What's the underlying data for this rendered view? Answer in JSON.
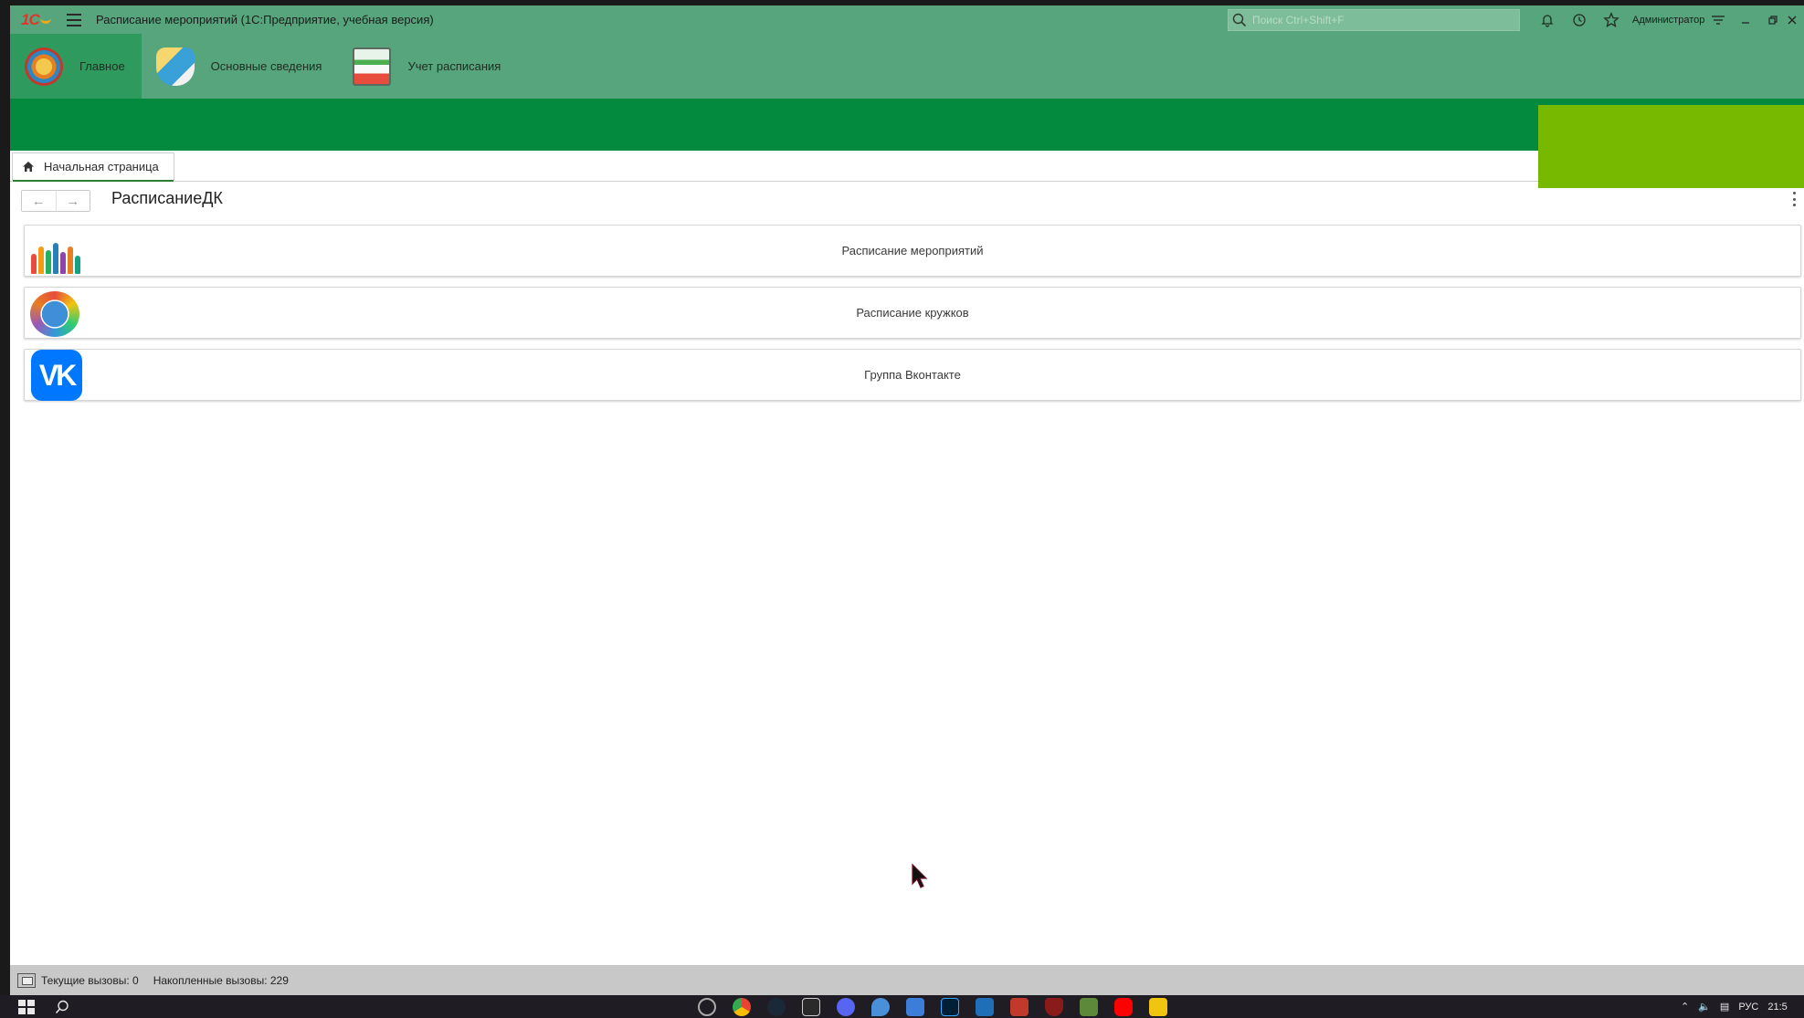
{
  "titlebar": {
    "title": "Расписание мероприятий  (1С:Предприятие, учебная версия)",
    "search_placeholder": "Поиск Ctrl+Shift+F",
    "user": "Администратор"
  },
  "sections": [
    {
      "label": "Главное",
      "active": true
    },
    {
      "label": "Основные сведения",
      "active": false
    },
    {
      "label": "Учет расписания",
      "active": false
    }
  ],
  "tabs": {
    "home_label": "Начальная страница"
  },
  "form": {
    "title": "РасписаниеДК"
  },
  "commands": [
    {
      "label": "Расписание мероприятий",
      "icon": "people-icon"
    },
    {
      "label": "Расписание кружков",
      "icon": "globe-people-icon"
    },
    {
      "label": "Группа Вконтакте",
      "icon": "vk-icon",
      "icon_text": "VK"
    }
  ],
  "statusbar": {
    "current_calls": "Текущие вызовы: 0",
    "accumulated_calls": "Накопленные вызовы: 229"
  },
  "taskbar": {
    "tray_lang": "РУС",
    "tray_time": "21:5"
  },
  "colors": {
    "titlebar": "#56a57c",
    "section_active": "#2e9a5d",
    "green_band": "#038a3e",
    "lime_block": "#77b800",
    "vk_blue": "#0077ff"
  }
}
